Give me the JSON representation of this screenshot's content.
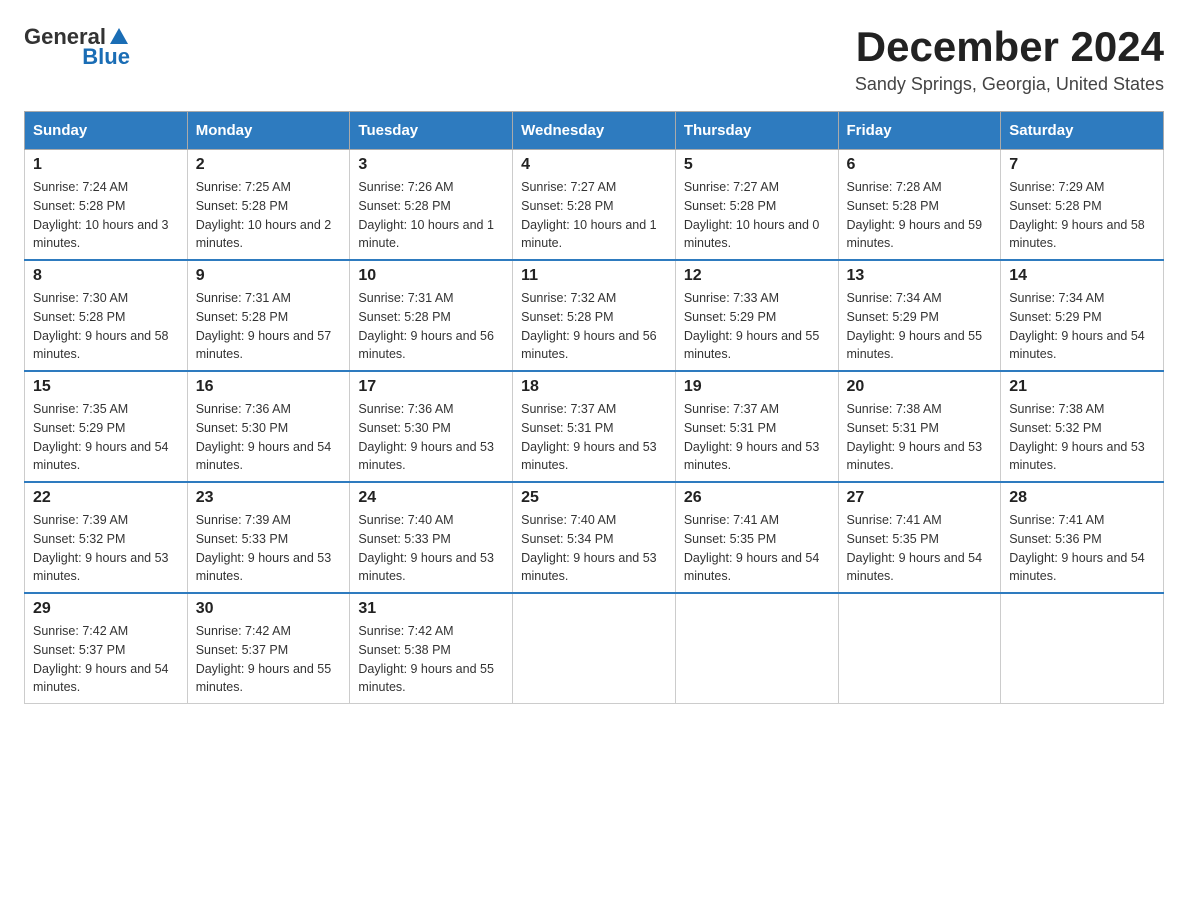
{
  "header": {
    "logo_general": "General",
    "logo_blue": "Blue",
    "month_year": "December 2024",
    "location": "Sandy Springs, Georgia, United States"
  },
  "days_of_week": [
    "Sunday",
    "Monday",
    "Tuesday",
    "Wednesday",
    "Thursday",
    "Friday",
    "Saturday"
  ],
  "weeks": [
    [
      {
        "day": "1",
        "sunrise": "7:24 AM",
        "sunset": "5:28 PM",
        "daylight": "10 hours and 3 minutes."
      },
      {
        "day": "2",
        "sunrise": "7:25 AM",
        "sunset": "5:28 PM",
        "daylight": "10 hours and 2 minutes."
      },
      {
        "day": "3",
        "sunrise": "7:26 AM",
        "sunset": "5:28 PM",
        "daylight": "10 hours and 1 minute."
      },
      {
        "day": "4",
        "sunrise": "7:27 AM",
        "sunset": "5:28 PM",
        "daylight": "10 hours and 1 minute."
      },
      {
        "day": "5",
        "sunrise": "7:27 AM",
        "sunset": "5:28 PM",
        "daylight": "10 hours and 0 minutes."
      },
      {
        "day": "6",
        "sunrise": "7:28 AM",
        "sunset": "5:28 PM",
        "daylight": "9 hours and 59 minutes."
      },
      {
        "day": "7",
        "sunrise": "7:29 AM",
        "sunset": "5:28 PM",
        "daylight": "9 hours and 58 minutes."
      }
    ],
    [
      {
        "day": "8",
        "sunrise": "7:30 AM",
        "sunset": "5:28 PM",
        "daylight": "9 hours and 58 minutes."
      },
      {
        "day": "9",
        "sunrise": "7:31 AM",
        "sunset": "5:28 PM",
        "daylight": "9 hours and 57 minutes."
      },
      {
        "day": "10",
        "sunrise": "7:31 AM",
        "sunset": "5:28 PM",
        "daylight": "9 hours and 56 minutes."
      },
      {
        "day": "11",
        "sunrise": "7:32 AM",
        "sunset": "5:28 PM",
        "daylight": "9 hours and 56 minutes."
      },
      {
        "day": "12",
        "sunrise": "7:33 AM",
        "sunset": "5:29 PM",
        "daylight": "9 hours and 55 minutes."
      },
      {
        "day": "13",
        "sunrise": "7:34 AM",
        "sunset": "5:29 PM",
        "daylight": "9 hours and 55 minutes."
      },
      {
        "day": "14",
        "sunrise": "7:34 AM",
        "sunset": "5:29 PM",
        "daylight": "9 hours and 54 minutes."
      }
    ],
    [
      {
        "day": "15",
        "sunrise": "7:35 AM",
        "sunset": "5:29 PM",
        "daylight": "9 hours and 54 minutes."
      },
      {
        "day": "16",
        "sunrise": "7:36 AM",
        "sunset": "5:30 PM",
        "daylight": "9 hours and 54 minutes."
      },
      {
        "day": "17",
        "sunrise": "7:36 AM",
        "sunset": "5:30 PM",
        "daylight": "9 hours and 53 minutes."
      },
      {
        "day": "18",
        "sunrise": "7:37 AM",
        "sunset": "5:31 PM",
        "daylight": "9 hours and 53 minutes."
      },
      {
        "day": "19",
        "sunrise": "7:37 AM",
        "sunset": "5:31 PM",
        "daylight": "9 hours and 53 minutes."
      },
      {
        "day": "20",
        "sunrise": "7:38 AM",
        "sunset": "5:31 PM",
        "daylight": "9 hours and 53 minutes."
      },
      {
        "day": "21",
        "sunrise": "7:38 AM",
        "sunset": "5:32 PM",
        "daylight": "9 hours and 53 minutes."
      }
    ],
    [
      {
        "day": "22",
        "sunrise": "7:39 AM",
        "sunset": "5:32 PM",
        "daylight": "9 hours and 53 minutes."
      },
      {
        "day": "23",
        "sunrise": "7:39 AM",
        "sunset": "5:33 PM",
        "daylight": "9 hours and 53 minutes."
      },
      {
        "day": "24",
        "sunrise": "7:40 AM",
        "sunset": "5:33 PM",
        "daylight": "9 hours and 53 minutes."
      },
      {
        "day": "25",
        "sunrise": "7:40 AM",
        "sunset": "5:34 PM",
        "daylight": "9 hours and 53 minutes."
      },
      {
        "day": "26",
        "sunrise": "7:41 AM",
        "sunset": "5:35 PM",
        "daylight": "9 hours and 54 minutes."
      },
      {
        "day": "27",
        "sunrise": "7:41 AM",
        "sunset": "5:35 PM",
        "daylight": "9 hours and 54 minutes."
      },
      {
        "day": "28",
        "sunrise": "7:41 AM",
        "sunset": "5:36 PM",
        "daylight": "9 hours and 54 minutes."
      }
    ],
    [
      {
        "day": "29",
        "sunrise": "7:42 AM",
        "sunset": "5:37 PM",
        "daylight": "9 hours and 54 minutes."
      },
      {
        "day": "30",
        "sunrise": "7:42 AM",
        "sunset": "5:37 PM",
        "daylight": "9 hours and 55 minutes."
      },
      {
        "day": "31",
        "sunrise": "7:42 AM",
        "sunset": "5:38 PM",
        "daylight": "9 hours and 55 minutes."
      },
      null,
      null,
      null,
      null
    ]
  ]
}
